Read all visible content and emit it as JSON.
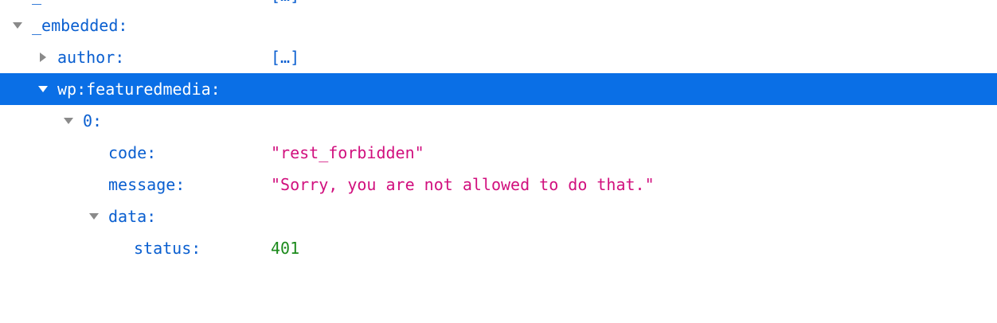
{
  "tree": {
    "partial_row": {
      "key": "_",
      "value": "[…]"
    },
    "embedded": {
      "key": "_embedded:"
    },
    "author": {
      "key": "author:",
      "value": "[…]"
    },
    "featuredmedia": {
      "key": "wp:featuredmedia:"
    },
    "item0": {
      "key": "0:"
    },
    "code": {
      "key": "code:",
      "value": "\"rest_forbidden\""
    },
    "message": {
      "key": "message:",
      "value": "\"Sorry, you are not allowed to do that.\""
    },
    "data": {
      "key": "data:"
    },
    "status": {
      "key": "status:",
      "value": "401"
    }
  },
  "colors": {
    "key": "#0a5fd0",
    "string": "#d1107e",
    "number": "#1b8a1b",
    "selection": "#0a6fe6",
    "twisty": "#8a8a8a"
  }
}
